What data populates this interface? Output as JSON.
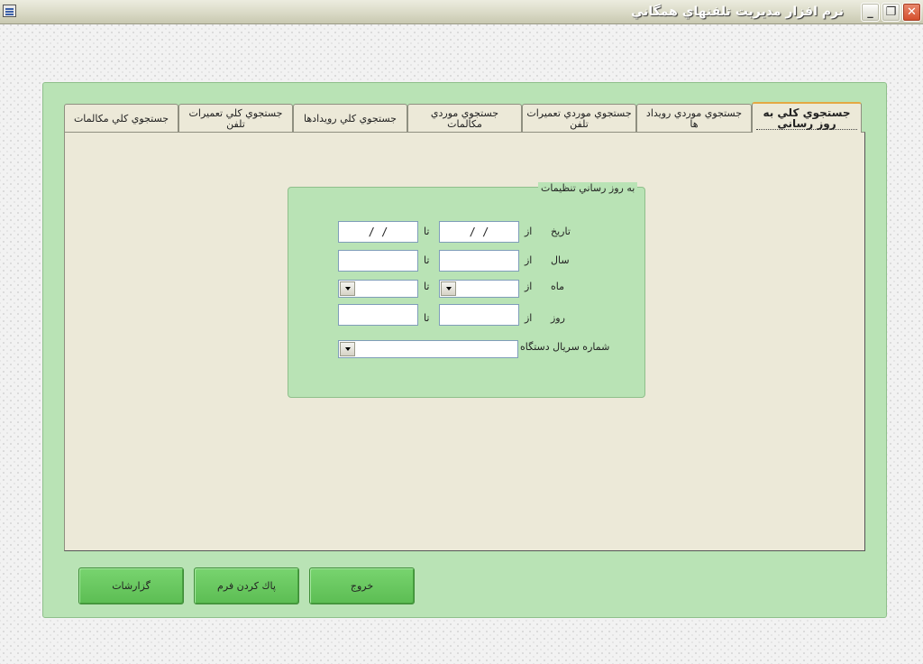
{
  "window": {
    "title": "نرم افزار مديريت تلفنهاي همگاني",
    "minimize_glyph": "_",
    "restore_glyph": "❐",
    "close_glyph": "✕"
  },
  "tabs": [
    {
      "label": "جستجوي كلي به روز رساني",
      "active": true
    },
    {
      "label": "جستجوي موردي رويداد ها",
      "active": false
    },
    {
      "label": "جستجوي موردي تعميرات تلفن",
      "active": false
    },
    {
      "label": "جستجوي موردي مكالمات",
      "active": false
    },
    {
      "label": "جستجوي كلي رويدادها",
      "active": false
    },
    {
      "label": "جستجوي كلي تعميرات تلفن",
      "active": false
    },
    {
      "label": "جستجوي كلي مكالمات",
      "active": false
    }
  ],
  "group": {
    "caption": "به روز رساني تنظيمات",
    "rows": {
      "date": {
        "label": "تاريخ",
        "from_label": "از",
        "to_label": "تا",
        "from_value": "/ /",
        "to_value": "/ /"
      },
      "year": {
        "label": "سال",
        "from_label": "از",
        "to_label": "تا",
        "from_value": "",
        "to_value": ""
      },
      "month": {
        "label": "ماه",
        "from_label": "از",
        "to_label": "تا",
        "from_value": "",
        "to_value": ""
      },
      "day": {
        "label": "روز",
        "from_label": "از",
        "to_label": "تا",
        "from_value": "",
        "to_value": ""
      }
    },
    "serial": {
      "label": "شماره سريال دستگاه",
      "value": ""
    }
  },
  "buttons": {
    "exit": "خروج",
    "clear_form": "پاك كردن فرم",
    "reports": "گزارشات"
  },
  "colors": {
    "accent_green": "#b9e3b5",
    "button_green": "#5cbd53",
    "panel_beige": "#ece9d8",
    "active_tab_highlight": "#e4a843"
  },
  "icons": {
    "app": "app-window-icon",
    "minimize": "minimize-icon",
    "restore": "restore-icon",
    "close": "close-icon",
    "dropdown": "chevron-down-icon"
  }
}
